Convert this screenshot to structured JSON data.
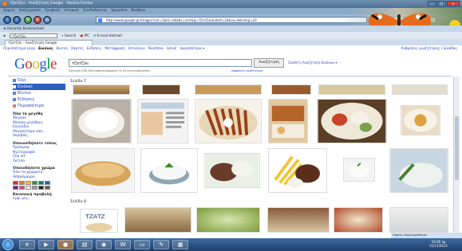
{
  "window": {
    "title": "τζατζίκι - Αναζήτηση Google - Mozilla Firefox"
  },
  "menu": [
    "Αρχείο",
    "Επεξεργασία",
    "Προβολή",
    "Ιστορικό",
    "Σελιδοδείκτες",
    "Εργαλεία",
    "Βοήθεια"
  ],
  "nav": {
    "url": "http://www.google.gr/images?um=1&hl=el&tbs=isch&q=τζατζίκι&start=20&sa=N&ndsp=20",
    "search_placeholder": "Google"
  },
  "bookmarks": {
    "label": "Recently Bookmarked"
  },
  "toolbar2": {
    "select_value": "τζατζίκι",
    "search_label": "Search",
    "ipc_label": "IPC",
    "email_label": "E-mail Hotmail"
  },
  "tab": {
    "label": "τζατζίκι - Αναζήτηση Google"
  },
  "gbar": {
    "links": [
      "Περισσότερα εργα",
      "Εικόνες",
      "Βίντεο",
      "Χάρτες",
      "Ειδήσεις",
      "Μετάφραση",
      "Ιστολόγιο",
      "Realtime",
      "Gmail",
      "περισσότερα ▾"
    ],
    "right": "Ρυθμίσεις αναζήτησης | Είσοδος"
  },
  "search": {
    "query": "τζατζίκι",
    "button": "Αναζήτηση",
    "advanced": "Σύνθετη Αναζήτηση Εικόνων ▾",
    "results": "Σχετικά 290.000 αποτελέσματα (0,16 δευτερόλεπτα)",
    "safe": "Ασφαλής αναζήτηση"
  },
  "logo": {
    "letters": [
      "G",
      "o",
      "o",
      "g",
      "l",
      "e"
    ],
    "colors": [
      "#1a5fd6",
      "#d62d20",
      "#f4b400",
      "#1a5fd6",
      "#009933",
      "#d62d20"
    ]
  },
  "sidebar": {
    "items": [
      "Όλα",
      "Εικόνες",
      "Βίντεο",
      "Ειδήσεις",
      "Περισσότερα"
    ],
    "size_head": "Όλα τα μεγέθη",
    "sizes": [
      "Μεγάλο",
      "Μεσαίο μεγέθους",
      "Εικονίδιο",
      "Μεγαλύτερα από...",
      "Ακριβώς..."
    ],
    "type_head": "Οποιοσδήποτε τύπος",
    "types": [
      "Πρόσωπα",
      "Φωτογραφία",
      "Clip art",
      "Σκίτσο"
    ],
    "color_head": "Οποιοδήποτε χρώμα",
    "colors_label": [
      "Όλα τα χρώματα",
      "Ασπρόμαυρο"
    ],
    "swatch_colors": [
      "#d32f2f",
      "#f57c00",
      "#fbc02d",
      "#388e3c",
      "#00838f",
      "#1565c0",
      "#6a1b9a",
      "#ec407a",
      "#ffffff",
      "#9e9e9e",
      "#212121",
      "#795548"
    ],
    "view_head": "Κανονική προβολή",
    "view_link": "Εμφ. μεγ."
  },
  "sections": {
    "s7": "Σελίδα 7",
    "s8": "Σελίδα 8"
  },
  "downloads": "Λήψεις ολοκληρώθηκαν",
  "clock": {
    "time": "10:06 πμ",
    "date": "11/11/2011"
  }
}
